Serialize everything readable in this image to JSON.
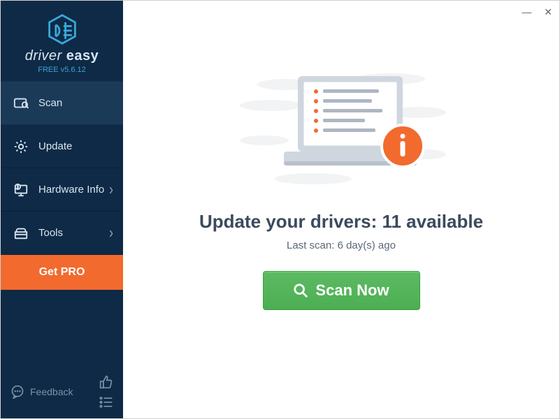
{
  "app": {
    "name_a": "driver",
    "name_b": "easy",
    "version": "FREE v5.6.12"
  },
  "nav": {
    "scan": "Scan",
    "update": "Update",
    "hardware_info": "Hardware Info",
    "tools": "Tools"
  },
  "cta": {
    "get_pro": "Get PRO"
  },
  "footer": {
    "feedback": "Feedback"
  },
  "main": {
    "headline": "Update your drivers: 11 available",
    "subhead": "Last scan: 6 day(s) ago",
    "scan_button": "Scan Now"
  }
}
